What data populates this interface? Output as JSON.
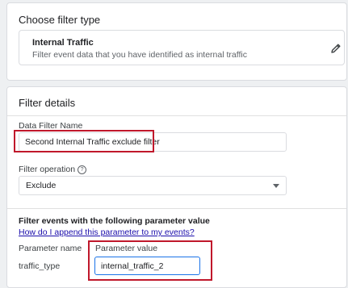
{
  "filter_type_card": {
    "title": "Choose filter type",
    "selected_type": {
      "name": "Internal Traffic",
      "description": "Filter event data that you have identified as internal traffic",
      "edit_icon": "pencil-icon"
    }
  },
  "filter_details_card": {
    "title": "Filter details",
    "data_filter_name": {
      "label": "Data Filter Name",
      "value": "Second Internal Traffic exclude filter"
    },
    "filter_operation": {
      "label": "Filter operation",
      "help_icon": "help-circle-icon",
      "selected": "Exclude"
    },
    "parameter_section": {
      "title": "Filter events with the following parameter value",
      "help_link": "How do I append this parameter to my events?",
      "column_parameter_name": "Parameter name",
      "column_parameter_value": "Parameter value",
      "parameter_name_value": "traffic_type",
      "parameter_value_input": "internal_traffic_2"
    }
  },
  "colors": {
    "highlight_box": "#c0182b",
    "link": "#1a0dab",
    "card_border": "#dadce0"
  }
}
